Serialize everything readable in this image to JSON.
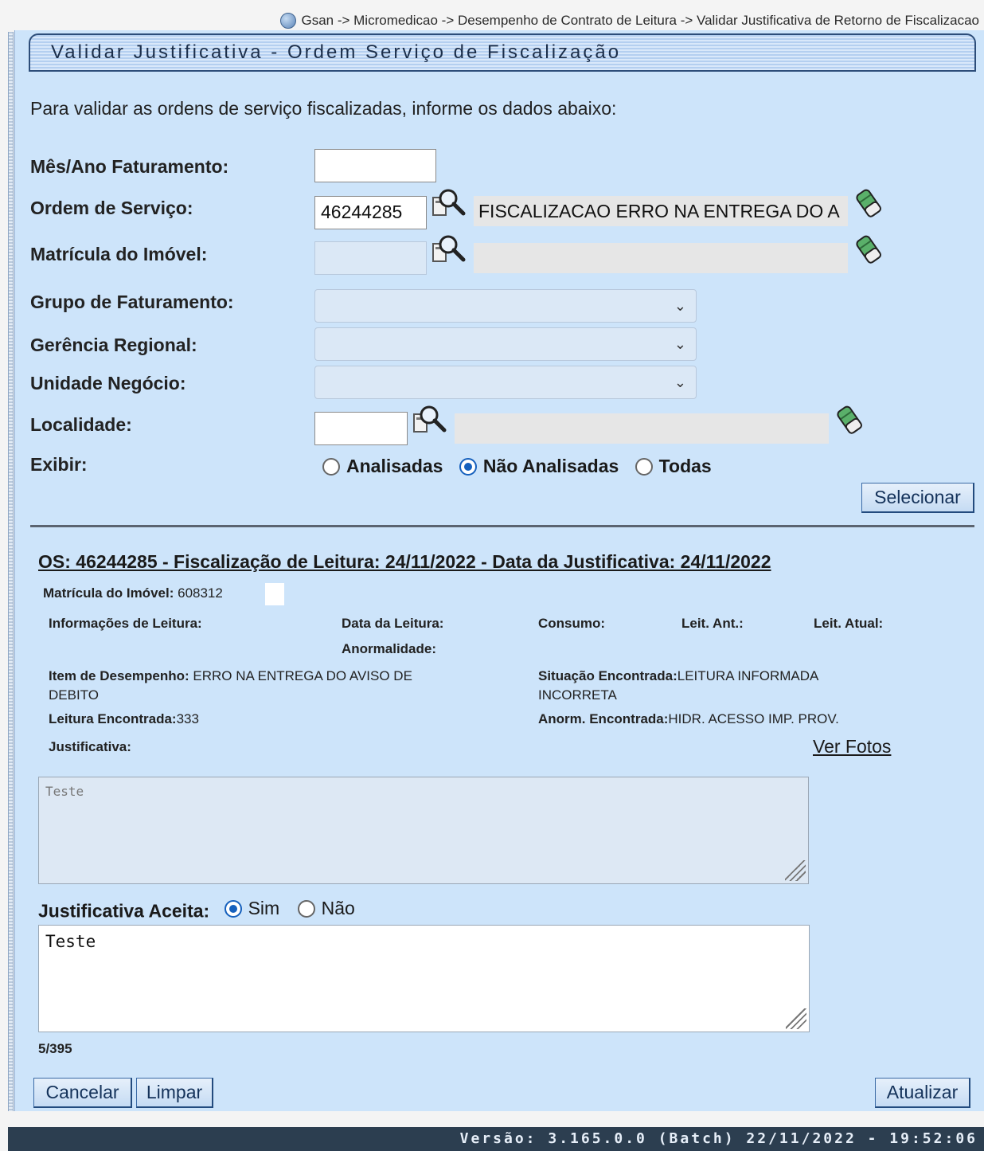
{
  "breadcrumb": "Gsan -> Micromedicao -> Desempenho de Contrato de Leitura -> Validar Justificativa de Retorno de Fiscalizacao",
  "page_title": "Validar Justificativa - Ordem Serviço de Fiscalização",
  "intro": "Para validar as ordens de serviço fiscalizadas, informe os dados abaixo:",
  "form": {
    "mes_ano_label": "Mês/Ano Faturamento:",
    "mes_ano_value": "",
    "ordem_label": "Ordem de Serviço:",
    "ordem_value": "46244285",
    "ordem_desc": "FISCALIZACAO ERRO NA ENTREGA DO A",
    "matricula_label": "Matrícula do Imóvel:",
    "matricula_value": "",
    "matricula_desc": "",
    "grupo_label": "Grupo de Faturamento:",
    "gerencia_label": "Gerência Regional:",
    "unidade_label": "Unidade Negócio:",
    "localidade_label": "Localidade:",
    "localidade_value": "",
    "localidade_desc": "",
    "exibir_label": "Exibir:",
    "exibir_options": [
      "Analisadas",
      "Não Analisadas",
      "Todas"
    ],
    "exibir_selected": "Não Analisadas",
    "selecionar_label": "Selecionar"
  },
  "detail": {
    "os_title": "OS: 46244285 - Fiscalização de Leitura: 24/11/2022 - Data da Justificativa: 24/11/2022",
    "matricula_label": "Matrícula do Imóvel:",
    "matricula_value": "608312",
    "info_leitura_label": "Informações de Leitura:",
    "data_leitura_label": "Data da Leitura:",
    "consumo_label": "Consumo:",
    "leit_ant_label": "Leit. Ant.:",
    "leit_atual_label": "Leit. Atual:",
    "anormalidade_label": "Anormalidade:",
    "item_desempenho_label": "Item de Desempenho:",
    "item_desempenho_value": "ERRO NA ENTREGA DO AVISO DE",
    "item_desempenho_value2": "DEBITO",
    "situacao_label": "Situação Encontrada:",
    "situacao_value": "LEITURA INFORMADA",
    "situacao_value2": "INCORRETA",
    "leitura_encontrada_label": "Leitura Encontrada:",
    "leitura_encontrada_value": "333",
    "anorm_encontrada_label": "Anorm. Encontrada:",
    "anorm_encontrada_value": "HIDR. ACESSO IMP. PROV.",
    "justificativa_label": "Justificativa:",
    "ver_fotos": "Ver Fotos",
    "justificativa_text": "Teste",
    "aceita_label": "Justificativa Aceita:",
    "aceita_options": [
      "Sim",
      "Não"
    ],
    "aceita_selected": "Sim",
    "observacao_text": "Teste",
    "char_count": "5/395"
  },
  "buttons": {
    "cancelar": "Cancelar",
    "limpar": "Limpar",
    "atualizar": "Atualizar"
  },
  "footer": "Versão: 3.165.0.0 (Batch) 22/11/2022 - 19:52:06"
}
